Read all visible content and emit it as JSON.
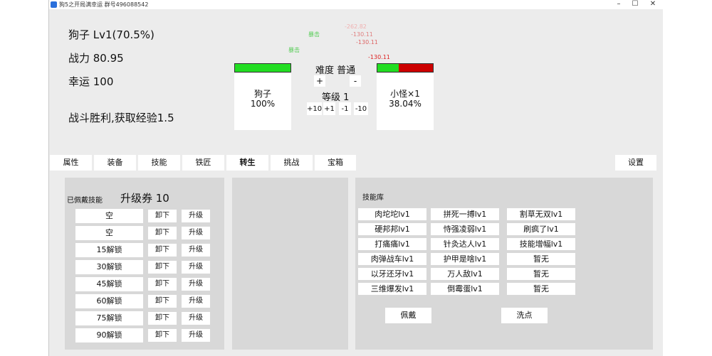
{
  "window": {
    "title": "狗5之开局满幸运 群号496088542",
    "min": "–",
    "max": "☐",
    "close": "✕"
  },
  "stats": {
    "name_level": "狗子 Lv1(70.5%)",
    "power": "战力 80.95",
    "luck": "幸运 100",
    "battle_result": "战斗胜利,获取经验1.5"
  },
  "floating_numbers": {
    "crit1": "暴击",
    "crit2": "暴击",
    "dmg1": "-262.82",
    "dmg2": "-130.11",
    "dmg3": "-130.11",
    "dmg4": "-130.11"
  },
  "player_card": {
    "name": "狗子",
    "hp_text": "100%",
    "hp_fraction": 1.0
  },
  "enemy_card": {
    "name": "小怪×1",
    "hp_text": "38.04%",
    "hp_fraction": 0.3804
  },
  "difficulty": {
    "label": "难度 普通",
    "plus": "+",
    "minus": "-",
    "level_label": "等级 1",
    "level_buttons": [
      "+10",
      "+1",
      "-1",
      "-10"
    ]
  },
  "tabs": [
    {
      "label": "属性"
    },
    {
      "label": "装备"
    },
    {
      "label": "技能"
    },
    {
      "label": "铁匠"
    },
    {
      "label": "转生"
    },
    {
      "label": "挑战"
    },
    {
      "label": "宝箱"
    },
    {
      "label": "设置"
    }
  ],
  "equipped": {
    "title": "已佩戴技能",
    "tickets": "升级券 10",
    "unequip": "卸下",
    "upgrade": "升级",
    "slots": [
      "空",
      "空",
      "15解锁",
      "30解锁",
      "45解锁",
      "60解锁",
      "75解锁",
      "90解锁"
    ]
  },
  "library": {
    "title": "技能库",
    "skills": [
      "肉坨坨lv1",
      "拼死一搏lv1",
      "割草无双lv1",
      "硬邦邦lv1",
      "恃强凌弱lv1",
      "刷疯了lv1",
      "打痛痛lv1",
      "针灸达人lv1",
      "技能增幅lv1",
      "肉弹战车lv1",
      "护甲是啥lv1",
      "暂无",
      "以牙还牙lv1",
      "万人敌lv1",
      "暂无",
      "三维爆发lv1",
      "倒霉蛋lv1",
      "暂无"
    ],
    "equip_button": "佩戴",
    "reset_button": "洗点"
  },
  "colors": {
    "hp_green": "#22dd22",
    "hp_red": "#cc0000",
    "crit_green": "#55cc55",
    "damage_red": "#e06060"
  }
}
